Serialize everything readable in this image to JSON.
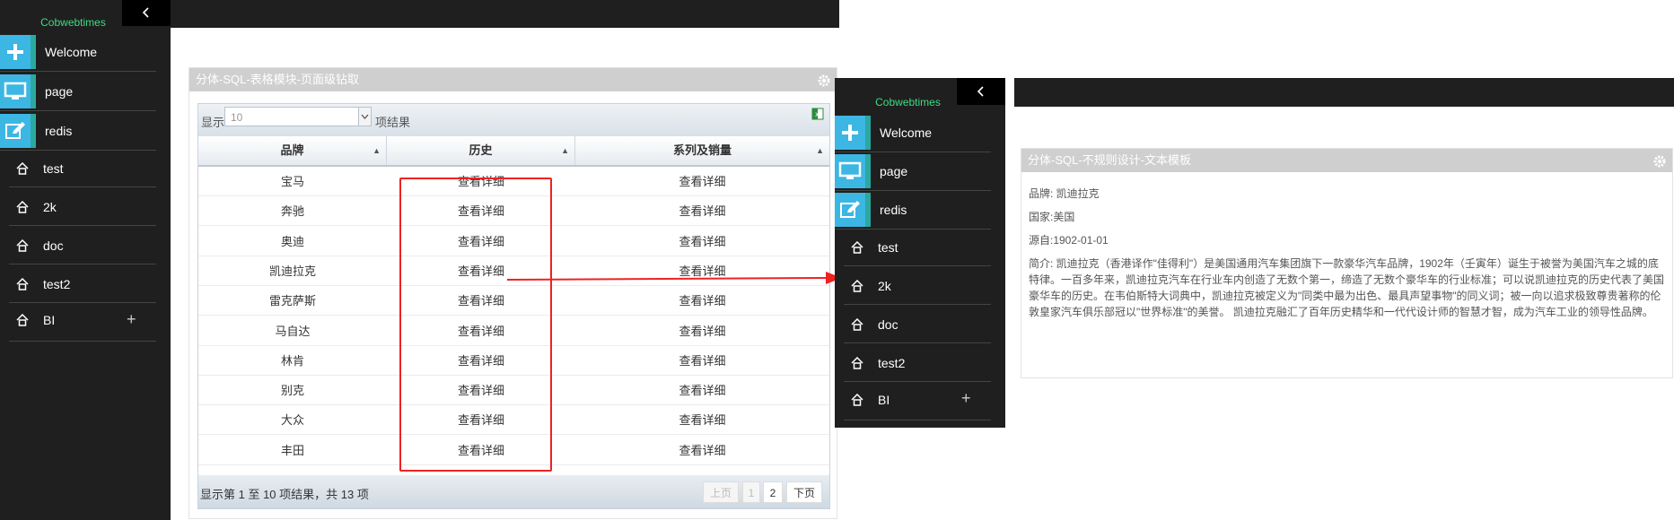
{
  "colors": {
    "sidebar_bg": "#1f1f1f",
    "accent_blue": "#3cb6e3",
    "accent_teal": "#2aa9a0",
    "brand_green": "#3ddc84",
    "highlight_red": "#ee2222"
  },
  "brand": "Cobwebtimes",
  "nav": {
    "main_items": [
      {
        "label": "Welcome",
        "icon": "plus-icon"
      },
      {
        "label": "page",
        "icon": "monitor-icon"
      },
      {
        "label": "redis",
        "icon": "edit-icon"
      }
    ],
    "sub_items": [
      {
        "label": "test",
        "icon": "home-icon"
      },
      {
        "label": "2k",
        "icon": "home-icon"
      },
      {
        "label": "doc",
        "icon": "home-icon"
      },
      {
        "label": "test2",
        "icon": "home-icon"
      },
      {
        "label": "BI",
        "icon": "home-icon",
        "expand_icon": "plus-icon"
      }
    ]
  },
  "table_panel": {
    "title": "分体-SQL-表格模块-页面级钻取",
    "length_prefix": "显示",
    "length_value": "10",
    "length_suffix": "项结果",
    "columns": [
      "品牌",
      "历史",
      "系列及销量"
    ],
    "rows": [
      [
        "宝马",
        "查看详细",
        "查看详细"
      ],
      [
        "奔驰",
        "查看详细",
        "查看详细"
      ],
      [
        "奥迪",
        "查看详细",
        "查看详细"
      ],
      [
        "凯迪拉克",
        "查看详细",
        "查看详细"
      ],
      [
        "雷克萨斯",
        "查看详细",
        "查看详细"
      ],
      [
        "马自达",
        "查看详细",
        "查看详细"
      ],
      [
        "林肯",
        "查看详细",
        "查看详细"
      ],
      [
        "别克",
        "查看详细",
        "查看详细"
      ],
      [
        "大众",
        "查看详细",
        "查看详细"
      ],
      [
        "丰田",
        "查看详细",
        "查看详细"
      ]
    ],
    "footer_info": "显示第 1 至 10 项结果，共 13 项",
    "pagination": {
      "prev": "上页",
      "pages": [
        "1",
        "2"
      ],
      "next": "下页"
    }
  },
  "detail_panel": {
    "title": "分体-SQL-不规则设计-文本模板",
    "brand_line": "品牌: 凯迪拉克",
    "country_line": "国家:美国",
    "origin_line": "源自:1902-01-01",
    "intro": "简介: 凯迪拉克（香港译作\"佳得利\"）是美国通用汽车集团旗下一款豪华汽车品牌，1902年（壬寅年）诞生于被誉为美国汽车之城的底特律。一百多年来，凯迪拉克汽车在行业车内创造了无数个第一，缔造了无数个豪华车的行业标准；可以说凯迪拉克的历史代表了美国豪华车的历史。在韦伯斯特大词典中，凯迪拉克被定义为\"同类中最为出色、最具声望事物\"的同义词；被一向以追求极致尊贵著称的伦敦皇家汽车俱乐部冠以\"世界标准\"的美誉。 凯迪拉克融汇了百年历史精华和一代代设计师的智慧才智，成为汽车工业的领导性品牌。"
  }
}
